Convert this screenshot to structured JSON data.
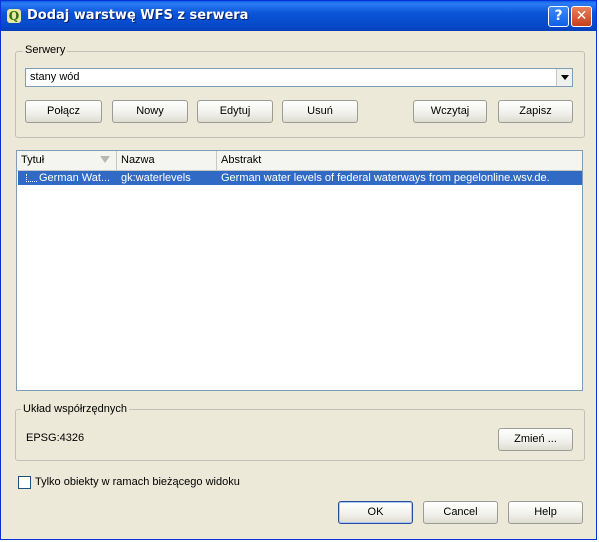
{
  "window": {
    "title": "Dodaj warstwę WFS z serwera",
    "app_icon": "qgis-icon",
    "help_label": "?",
    "close_label": "✕"
  },
  "servers": {
    "group_label": "Serwery",
    "selected": "stany wód",
    "buttons": {
      "connect": "Połącz",
      "new": "Nowy",
      "edit": "Edytuj",
      "delete": "Usuń",
      "load": "Wczytaj",
      "save": "Zapisz"
    }
  },
  "layers_table": {
    "columns": [
      "Tytuł",
      "Nazwa",
      "Abstrakt"
    ],
    "rows": [
      {
        "title": "German Wat...",
        "name": "gk:waterlevels",
        "abstract": "German water levels of federal waterways from pegelonline.wsv.de."
      }
    ]
  },
  "crs": {
    "group_label": "Układ współrzędnych",
    "value": "EPSG:4326",
    "change_label": "Zmień ..."
  },
  "filter_checkbox": {
    "label": "Tylko obiekty w ramach bieżącego widoku",
    "checked": false
  },
  "footer": {
    "ok": "OK",
    "cancel": "Cancel",
    "help": "Help"
  },
  "colors": {
    "titlebar": "#0a55d8",
    "selection": "#316ac5",
    "dialog_bg": "#ece9d8"
  }
}
